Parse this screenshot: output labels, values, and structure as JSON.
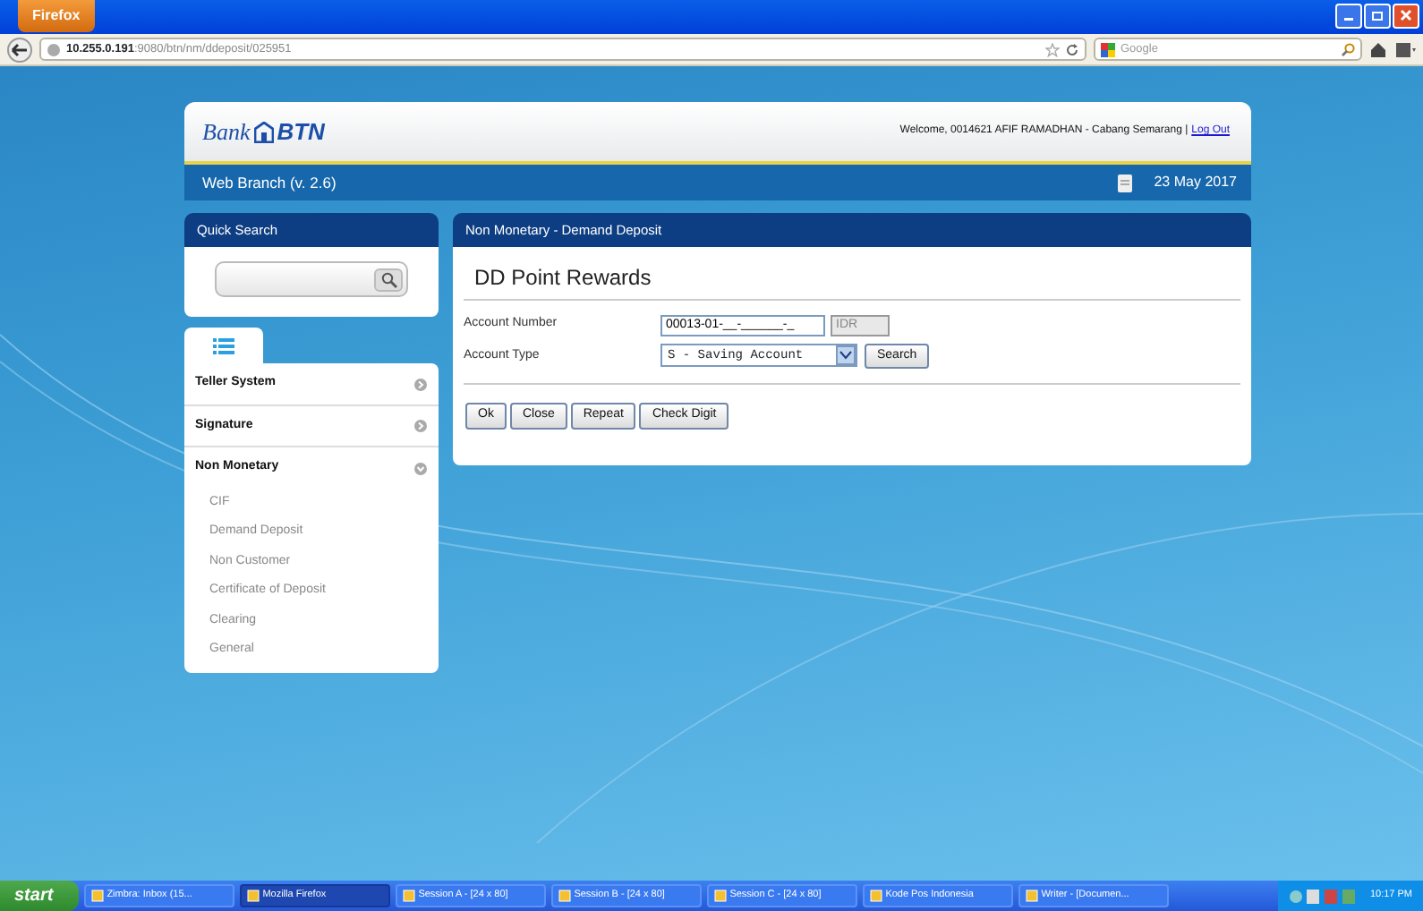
{
  "browser": {
    "menu_button": "Firefox",
    "url_host": "10.255.0.191",
    "url_path": ":9080/btn/nm/ddeposit/025951",
    "search_placeholder": "Google"
  },
  "header": {
    "logo_left": "Bank",
    "logo_right": "BTN",
    "welcome": "Welcome, 0014621  AFIF RAMADHAN - Cabang Semarang |",
    "logout": "Log Out",
    "app_name": "Web Branch  (v. 2.6)",
    "date": "23 May 2017"
  },
  "quick_search": {
    "title": "Quick Search"
  },
  "menu": [
    {
      "label": "Teller System",
      "expanded": false
    },
    {
      "label": "Signature",
      "expanded": false
    },
    {
      "label": "Non Monetary",
      "expanded": true,
      "children": [
        {
          "label": "CIF"
        },
        {
          "label": "Demand Deposit"
        },
        {
          "label": "Non Customer"
        },
        {
          "label": "Certificate of Deposit"
        },
        {
          "label": "Clearing"
        },
        {
          "label": "General"
        }
      ]
    }
  ],
  "main": {
    "breadcrumb": "Non Monetary - Demand Deposit",
    "title": "DD Point Rewards",
    "fields": [
      {
        "kind": "text",
        "label": "Account Number",
        "value": "00013-01-__-______-_",
        "suffix": "IDR"
      },
      {
        "kind": "select",
        "label": "Account Type",
        "value": "S - Saving Account",
        "button": "Search"
      }
    ],
    "buttons": [
      "Ok",
      "Close",
      "Repeat",
      "Check Digit"
    ]
  },
  "taskbar": {
    "start": "start",
    "items": [
      {
        "label": "Zimbra: Inbox (15...",
        "selected": false
      },
      {
        "label": "Mozilla Firefox",
        "selected": true
      },
      {
        "label": "Session A - [24 x 80]",
        "selected": false
      },
      {
        "label": "Session B - [24 x 80]",
        "selected": false
      },
      {
        "label": "Session C - [24 x 80]",
        "selected": false
      },
      {
        "label": "Kode Pos Indonesia",
        "selected": false
      },
      {
        "label": "Writer - [Documen...",
        "selected": false
      }
    ],
    "clock": "10:17 PM"
  }
}
